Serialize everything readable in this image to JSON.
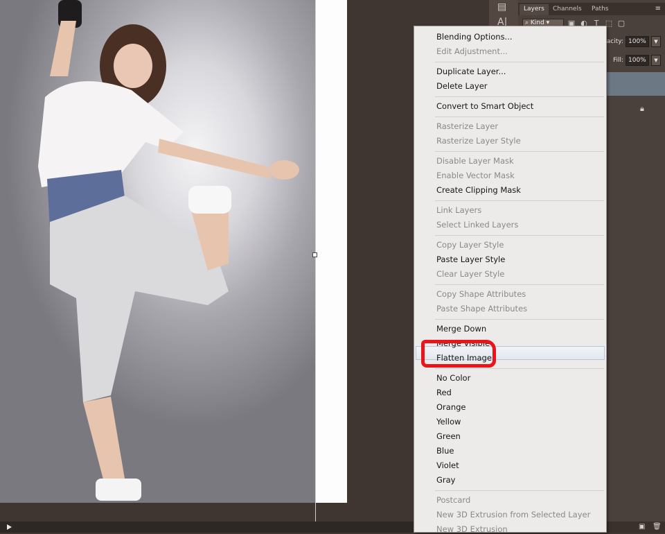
{
  "layers_panel": {
    "tabs": [
      "Layers",
      "Channels",
      "Paths"
    ],
    "kind_label": "Kind",
    "opacity_label": "acity:",
    "opacity_value": "100%",
    "fill_label": "Fill:",
    "fill_value": "100%"
  },
  "context_menu": {
    "highlighted": "Flatten Image",
    "groups": [
      [
        {
          "label": "Blending Options...",
          "enabled": true
        },
        {
          "label": "Edit Adjustment...",
          "enabled": false
        }
      ],
      [
        {
          "label": "Duplicate Layer...",
          "enabled": true
        },
        {
          "label": "Delete Layer",
          "enabled": true
        }
      ],
      [
        {
          "label": "Convert to Smart Object",
          "enabled": true
        }
      ],
      [
        {
          "label": "Rasterize Layer",
          "enabled": false
        },
        {
          "label": "Rasterize Layer Style",
          "enabled": false
        }
      ],
      [
        {
          "label": "Disable Layer Mask",
          "enabled": false
        },
        {
          "label": "Enable Vector Mask",
          "enabled": false
        },
        {
          "label": "Create Clipping Mask",
          "enabled": true
        }
      ],
      [
        {
          "label": "Link Layers",
          "enabled": false
        },
        {
          "label": "Select Linked Layers",
          "enabled": false
        }
      ],
      [
        {
          "label": "Copy Layer Style",
          "enabled": false
        },
        {
          "label": "Paste Layer Style",
          "enabled": true
        },
        {
          "label": "Clear Layer Style",
          "enabled": false
        }
      ],
      [
        {
          "label": "Copy Shape Attributes",
          "enabled": false
        },
        {
          "label": "Paste Shape Attributes",
          "enabled": false
        }
      ],
      [
        {
          "label": "Merge Down",
          "enabled": true
        },
        {
          "label": "Merge Visible",
          "enabled": true
        },
        {
          "label": "Flatten Image",
          "enabled": true
        }
      ],
      [
        {
          "label": "No Color",
          "enabled": true
        },
        {
          "label": "Red",
          "enabled": true
        },
        {
          "label": "Orange",
          "enabled": true
        },
        {
          "label": "Yellow",
          "enabled": true
        },
        {
          "label": "Green",
          "enabled": true
        },
        {
          "label": "Blue",
          "enabled": true
        },
        {
          "label": "Violet",
          "enabled": true
        },
        {
          "label": "Gray",
          "enabled": true
        }
      ],
      [
        {
          "label": "Postcard",
          "enabled": false
        },
        {
          "label": "New 3D Extrusion from Selected Layer",
          "enabled": false
        },
        {
          "label": "New 3D Extrusion",
          "enabled": false
        }
      ]
    ]
  },
  "colors": {
    "annotation_red": "#ea141a",
    "workspace_bg": "#3f3632",
    "menu_bg": "#ecebe9"
  }
}
